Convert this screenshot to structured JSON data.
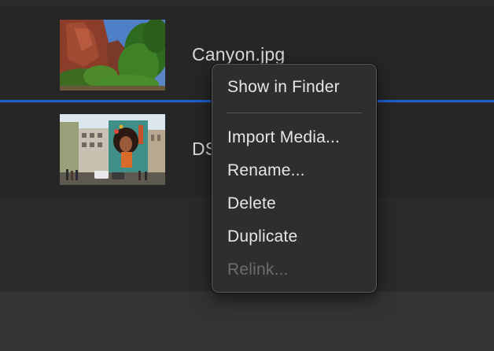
{
  "media_items": [
    {
      "filename": "Canyon.jpg",
      "thumbnail_icon": "canyon-photo-thumbnail"
    },
    {
      "filename": "DS",
      "thumbnail_icon": "mural-photo-thumbnail"
    }
  ],
  "context_menu": {
    "items": [
      {
        "label": "Show in Finder",
        "enabled": true
      },
      {
        "label": "Import Media...",
        "enabled": true
      },
      {
        "label": "Rename...",
        "enabled": true
      },
      {
        "label": "Delete",
        "enabled": true
      },
      {
        "label": "Duplicate",
        "enabled": true
      },
      {
        "label": "Relink...",
        "enabled": false
      }
    ]
  },
  "colors": {
    "selection_accent": "#1d5fd0",
    "menu_background": "#2e2e2e",
    "text_primary": "#e6e6e6",
    "text_disabled": "#6c6c6c"
  }
}
